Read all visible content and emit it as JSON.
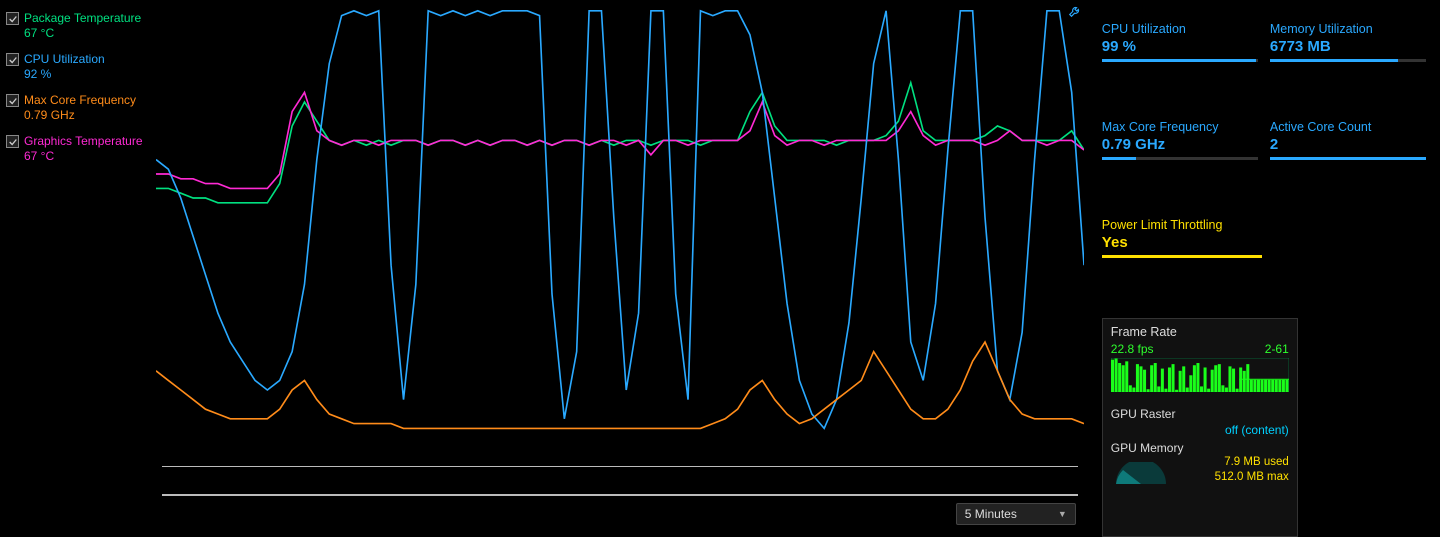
{
  "legend": {
    "items": [
      {
        "label": "Package Temperature",
        "value": "67 °C",
        "colorClass": "c-green",
        "checked": true
      },
      {
        "label": "CPU Utilization",
        "value": "92 %",
        "colorClass": "c-blue",
        "checked": true
      },
      {
        "label": "Max Core Frequency",
        "value": "0.79 GHz",
        "colorClass": "c-orange",
        "checked": true
      },
      {
        "label": "Graphics Temperature",
        "value": "67 °C",
        "colorClass": "c-magenta",
        "checked": true
      }
    ]
  },
  "time_range": {
    "selected": "5 Minutes"
  },
  "metrics": {
    "cpu_util": {
      "label": "CPU Utilization",
      "value": "99 %",
      "fill_pct": 99
    },
    "mem_util": {
      "label": "Memory Utilization",
      "value": "6773  MB",
      "fill_pct": 82
    },
    "max_core": {
      "label": "Max Core Frequency",
      "value": "0.79 GHz",
      "fill_pct": 22
    },
    "active_cores": {
      "label": "Active Core Count",
      "value": "2",
      "fill_pct": 100
    },
    "throttling": {
      "label": "Power Limit Throttling",
      "value": "Yes",
      "fill_pct": 100
    }
  },
  "frame_rate": {
    "title": "Frame Rate",
    "current": "22.8 fps",
    "range": "2-61",
    "gpu_raster_label": "GPU Raster",
    "gpu_raster_value": "off (content)",
    "gpu_mem_label": "GPU Memory",
    "gpu_mem_used": "7.9 MB used",
    "gpu_mem_max": "512.0 MB max"
  },
  "chart_data": {
    "type": "line",
    "x_range_minutes": 5,
    "y_range_pct": [
      0,
      100
    ],
    "xlabel": "",
    "ylabel": "",
    "series": [
      {
        "name": "Package Temperature (°C → pct of scale)",
        "color": "#00e080",
        "values": [
          62,
          62,
          61,
          60,
          60,
          59,
          59,
          59,
          59,
          59,
          63,
          75,
          80,
          76,
          72,
          71,
          72,
          71,
          72,
          71,
          72,
          72,
          71,
          72,
          72,
          71,
          72,
          71,
          72,
          72,
          71,
          72,
          71,
          72,
          72,
          71,
          72,
          71,
          72,
          72,
          71,
          72,
          72,
          72,
          71,
          72,
          72,
          72,
          78,
          82,
          75,
          72,
          72,
          72,
          72,
          71,
          72,
          72,
          72,
          73,
          76,
          84,
          74,
          72,
          72,
          72,
          72,
          73,
          75,
          74,
          72,
          72,
          72,
          72,
          74,
          70
        ]
      },
      {
        "name": "Graphics Temperature (°C → pct of scale)",
        "color": "#ff2ad4",
        "values": [
          65,
          65,
          64,
          64,
          63,
          63,
          62,
          62,
          62,
          62,
          65,
          78,
          82,
          74,
          72,
          71,
          72,
          72,
          71,
          72,
          72,
          72,
          71,
          72,
          72,
          71,
          72,
          71,
          72,
          72,
          71,
          72,
          71,
          72,
          72,
          71,
          72,
          72,
          71,
          72,
          69,
          72,
          72,
          71,
          72,
          72,
          72,
          72,
          74,
          80,
          73,
          71,
          72,
          72,
          71,
          72,
          72,
          72,
          72,
          72,
          74,
          78,
          73,
          71,
          72,
          72,
          72,
          71,
          72,
          74,
          72,
          72,
          71,
          72,
          72,
          70
        ]
      },
      {
        "name": "CPU Utilization (%)",
        "color": "#2aa9ff",
        "values": [
          68,
          66,
          60,
          52,
          44,
          36,
          30,
          26,
          22,
          20,
          22,
          28,
          42,
          68,
          88,
          98,
          99,
          98,
          99,
          46,
          18,
          42,
          99,
          98,
          99,
          98,
          99,
          98,
          99,
          99,
          99,
          98,
          40,
          14,
          28,
          99,
          99,
          56,
          20,
          36,
          99,
          99,
          40,
          18,
          99,
          98,
          99,
          99,
          94,
          82,
          60,
          38,
          22,
          15,
          12,
          18,
          34,
          60,
          88,
          99,
          68,
          30,
          22,
          38,
          70,
          99,
          99,
          56,
          24,
          18,
          32,
          68,
          99,
          99,
          82,
          46
        ]
      },
      {
        "name": "Max Core Frequency (GHz → pct of scale)",
        "color": "#ff8c1a",
        "values": [
          24,
          22,
          20,
          18,
          16,
          15,
          14,
          14,
          14,
          14,
          16,
          20,
          22,
          18,
          15,
          14,
          13,
          13,
          13,
          13,
          12,
          12,
          12,
          12,
          12,
          12,
          12,
          12,
          12,
          12,
          12,
          12,
          12,
          12,
          12,
          12,
          12,
          12,
          12,
          12,
          12,
          12,
          12,
          12,
          12,
          13,
          14,
          16,
          20,
          22,
          18,
          15,
          13,
          14,
          16,
          18,
          20,
          22,
          28,
          24,
          20,
          16,
          14,
          14,
          16,
          20,
          26,
          30,
          24,
          18,
          15,
          14,
          14,
          14,
          14,
          13
        ]
      }
    ],
    "frame_rate_spark": {
      "type": "bar",
      "values": [
        58,
        60,
        52,
        48,
        55,
        12,
        8,
        50,
        46,
        40,
        5,
        48,
        52,
        10,
        42,
        6,
        44,
        50,
        4,
        38,
        46,
        8,
        30,
        48,
        52,
        10,
        44,
        6,
        40,
        48,
        50,
        12,
        8,
        46,
        42,
        6,
        44,
        38,
        50,
        22,
        22,
        22,
        22,
        22,
        22,
        22,
        22,
        22,
        22,
        22
      ],
      "ylim": [
        0,
        61
      ]
    }
  }
}
